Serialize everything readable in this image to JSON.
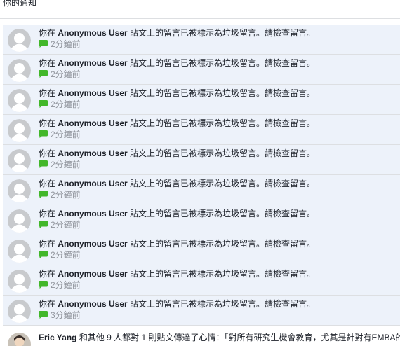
{
  "header": {
    "title": "你的通知"
  },
  "notifications": [
    {
      "prefix": "你在 ",
      "user": "Anonymous User",
      "suffix": " 貼文上的留言已被標示為垃圾留言。請檢查留言。",
      "time": "2分鐘前"
    },
    {
      "prefix": "你在 ",
      "user": "Anonymous User",
      "suffix": " 貼文上的留言已被標示為垃圾留言。請檢查留言。",
      "time": "2分鐘前"
    },
    {
      "prefix": "你在 ",
      "user": "Anonymous User",
      "suffix": " 貼文上的留言已被標示為垃圾留言。請檢查留言。",
      "time": "2分鐘前"
    },
    {
      "prefix": "你在 ",
      "user": "Anonymous User",
      "suffix": " 貼文上的留言已被標示為垃圾留言。請檢查留言。",
      "time": "2分鐘前"
    },
    {
      "prefix": "你在 ",
      "user": "Anonymous User",
      "suffix": " 貼文上的留言已被標示為垃圾留言。請檢查留言。",
      "time": "2分鐘前"
    },
    {
      "prefix": "你在 ",
      "user": "Anonymous User",
      "suffix": " 貼文上的留言已被標示為垃圾留言。請檢查留言。",
      "time": "2分鐘前"
    },
    {
      "prefix": "你在 ",
      "user": "Anonymous User",
      "suffix": " 貼文上的留言已被標示為垃圾留言。請檢查留言。",
      "time": "2分鐘前"
    },
    {
      "prefix": "你在 ",
      "user": "Anonymous User",
      "suffix": " 貼文上的留言已被標示為垃圾留言。請檢查留言。",
      "time": "2分鐘前"
    },
    {
      "prefix": "你在 ",
      "user": "Anonymous User",
      "suffix": " 貼文上的留言已被標示為垃圾留言。請檢查留言。",
      "time": "2分鐘前"
    },
    {
      "prefix": "你在 ",
      "user": "Anonymous User",
      "suffix": " 貼文上的留言已被標示為垃圾留言。請檢查留言。",
      "time": "3分鐘前"
    }
  ],
  "last_notification": {
    "user": "Eric Yang",
    "text": " 和其他 9 人都對 1 則貼文傳達了心情：「對所有研究生機會教育，尤其是針對有EMBA的"
  },
  "icons": {
    "comment": "green-comment-bubble-icon",
    "avatar": "default-avatar-icon"
  },
  "colors": {
    "unread_bg": "#edf2fa",
    "comment_icon": "#42b72a",
    "meta_text": "#90949c"
  }
}
